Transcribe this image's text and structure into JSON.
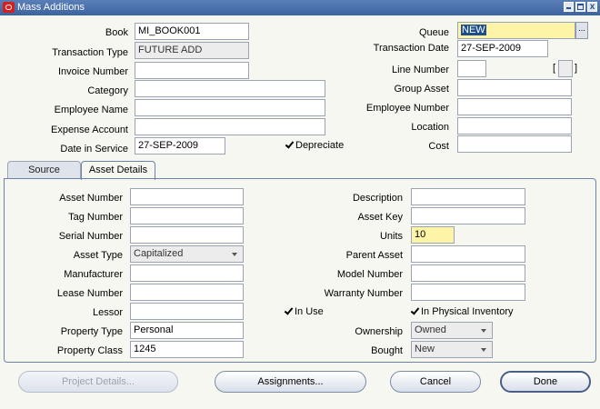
{
  "window": {
    "title": "Mass Additions"
  },
  "header": {
    "book": {
      "label": "Book",
      "value": "MI_BOOK001"
    },
    "transaction_type": {
      "label": "Transaction Type",
      "value": "FUTURE ADD"
    },
    "invoice_number": {
      "label": "Invoice Number",
      "value": ""
    },
    "category": {
      "label": "Category",
      "value": ""
    },
    "employee_name": {
      "label": "Employee Name",
      "value": ""
    },
    "expense_account": {
      "label": "Expense Account",
      "value": ""
    },
    "date_in_service": {
      "label": "Date in Service",
      "value": "27-SEP-2009"
    },
    "depreciate": {
      "label": "Depreciate",
      "checked": true
    },
    "queue": {
      "label": "Queue",
      "value": "NEW",
      "lov_label": "..."
    },
    "transaction_date": {
      "label": "Transaction Date",
      "value": "27-SEP-2009"
    },
    "line_number": {
      "label": "Line Number",
      "value": "",
      "flex_open": "[",
      "flex_close": "]"
    },
    "group_asset": {
      "label": "Group Asset",
      "value": ""
    },
    "employee_number": {
      "label": "Employee Number",
      "value": ""
    },
    "location": {
      "label": "Location",
      "value": ""
    },
    "cost": {
      "label": "Cost",
      "value": ""
    }
  },
  "tabs": [
    {
      "label": "Source",
      "active": false
    },
    {
      "label": "Asset Details",
      "active": true
    }
  ],
  "details": {
    "asset_number": {
      "label": "Asset Number",
      "value": ""
    },
    "tag_number": {
      "label": "Tag Number",
      "value": ""
    },
    "serial_number": {
      "label": "Serial Number",
      "value": ""
    },
    "asset_type": {
      "label": "Asset Type",
      "value": "Capitalized"
    },
    "manufacturer": {
      "label": "Manufacturer",
      "value": ""
    },
    "lease_number": {
      "label": "Lease Number",
      "value": ""
    },
    "lessor": {
      "label": "Lessor",
      "value": ""
    },
    "property_type": {
      "label": "Property Type",
      "value": "Personal"
    },
    "property_class": {
      "label": "Property Class",
      "value": "1245"
    },
    "description": {
      "label": "Description",
      "value": ""
    },
    "asset_key": {
      "label": "Asset Key",
      "value": ""
    },
    "units": {
      "label": "Units",
      "value": "10"
    },
    "parent_asset": {
      "label": "Parent Asset",
      "value": ""
    },
    "model_number": {
      "label": "Model Number",
      "value": ""
    },
    "warranty_number": {
      "label": "Warranty Number",
      "value": ""
    },
    "in_use": {
      "label": "In Use",
      "checked": true
    },
    "in_physical_inventory": {
      "label": "In Physical Inventory",
      "checked": true
    },
    "ownership": {
      "label": "Ownership",
      "value": "Owned"
    },
    "bought": {
      "label": "Bought",
      "value": "New"
    }
  },
  "buttons": {
    "project_details": "Project Details...",
    "assignments": "Assignments...",
    "cancel": "Cancel",
    "done": "Done"
  },
  "colors": {
    "title_bar": "#3d63a0",
    "required_field": "#fdf4a8",
    "selection": "#1e4e8c"
  }
}
